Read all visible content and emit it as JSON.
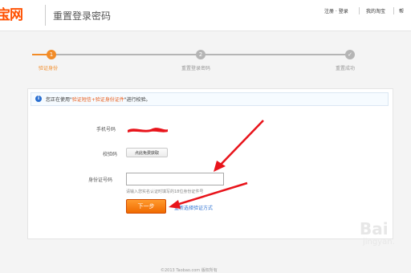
{
  "header": {
    "logo": "宝网",
    "title": "重置登录密码",
    "links": [
      "注册 · 登录",
      "我的淘宝",
      "帮"
    ]
  },
  "steps": [
    {
      "number": "1",
      "label": "验证身份",
      "state": "active"
    },
    {
      "number": "2",
      "label": "重置登录密码",
      "state": "pending"
    },
    {
      "number": "✓",
      "label": "重置成功",
      "state": "pending"
    }
  ],
  "notice": {
    "before": "您正在使用\"",
    "highlight": "验证短信+验证身份证件",
    "after": "\"进行校验。"
  },
  "form": {
    "phone_label": "手机号码",
    "code_label": "校验码",
    "sms_button": "点此免费获取",
    "id_label": "身份证号码",
    "id_value": "",
    "id_hint": "请输入您实名认证时填写的18位身份证件号",
    "next_button": "下一步",
    "switch_link": "重新选择验证方式"
  },
  "footer": {
    "text": "©2013 Taobao.com 版权所有"
  },
  "watermark": {
    "main": "Bai",
    "sub": "jingyan."
  },
  "colors": {
    "accent": "#ff5000",
    "step_active": "#f28c28",
    "step_inactive": "#b5b5b5",
    "annotation": "#e8141b",
    "link": "#2a6fd1"
  }
}
